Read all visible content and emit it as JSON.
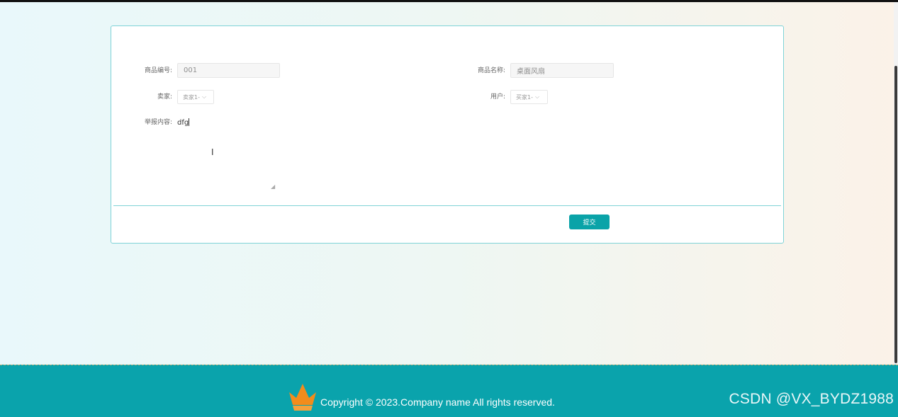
{
  "form": {
    "product_no_label": "商品编号:",
    "product_no_value": "001",
    "product_name_label": "商品名称:",
    "product_name_value": "桌面风扇",
    "seller_label": "卖家:",
    "seller_value": "卖家1-",
    "user_label": "用户:",
    "user_value": "买家1-",
    "report_label": "举报内容:",
    "report_value": "dfg",
    "submit_label": "提交"
  },
  "footer": {
    "copyright": "Copyright © 2023.Company name All rights reserved.",
    "watermark": "CSDN @VX_BYDZ1988"
  },
  "icons": {
    "dropdown": "chevron-down-icon",
    "resize": "resize-grip-icon",
    "cursor": "text-cursor-icon",
    "logo": "crown-icon"
  },
  "colors": {
    "accent": "#0aa3a8",
    "footer": "#0aa3ac",
    "panel_border": "#7fd3d7",
    "logo": "#f28c1c"
  }
}
